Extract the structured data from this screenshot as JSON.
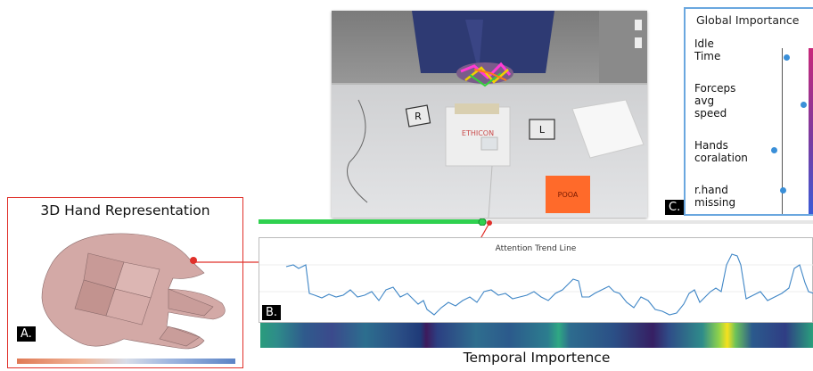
{
  "global_importance": {
    "title": "Global Importance",
    "features": [
      {
        "label": "Idle\nTime",
        "importance": 0.35
      },
      {
        "label": "Forceps\navg\nspeed",
        "importance": 0.82
      },
      {
        "label": "Hands\ncoralation",
        "importance": 0.0
      },
      {
        "label": "r.hand\nmissing",
        "importance": 0.25
      }
    ],
    "point_color": "#3a8fd8"
  },
  "panels": {
    "a_label": "A.",
    "b_label": "B.",
    "c_label": "C."
  },
  "hand_panel": {
    "title": "3D Hand Representation"
  },
  "attention": {
    "title": "Attention Trend Line",
    "line_color": "#3f86c6"
  },
  "temporal": {
    "title": "Temporal Importence"
  },
  "video": {
    "sign_text": "ETHICON",
    "tag_text": "POOA",
    "left_mark": "R",
    "right_mark": "L"
  },
  "timeline": {
    "progress": 0.41,
    "color": "#2fd14f"
  },
  "colors": {
    "accent_red": "#e0302a",
    "panel_blue": "#6aa7df"
  }
}
